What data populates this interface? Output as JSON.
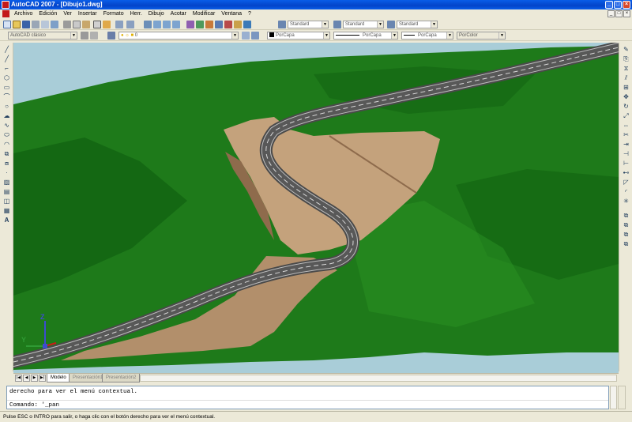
{
  "window": {
    "title": "AutoCAD 2007 - [Dibujo1.dwg]",
    "minimize_glyph": "_",
    "maximize_glyph": "□",
    "close_glyph": "×"
  },
  "menu": {
    "items": [
      {
        "label": "Archivo"
      },
      {
        "label": "Edición"
      },
      {
        "label": "Ver"
      },
      {
        "label": "Insertar"
      },
      {
        "label": "Formato"
      },
      {
        "label": "Herr."
      },
      {
        "label": "Dibujo"
      },
      {
        "label": "Acotar"
      },
      {
        "label": "Modificar"
      },
      {
        "label": "Ventana"
      },
      {
        "label": "?"
      }
    ],
    "doc_min": "_",
    "doc_max": "□",
    "doc_close": "×"
  },
  "toolbar1": {
    "text_style": "Standard",
    "dim_style": "Standard",
    "table_style": "Standard"
  },
  "toolbar2": {
    "workspace": "AutoCAD clásico",
    "layer": "0",
    "color": "PorCapa",
    "linetype": "PorCapa",
    "lineweight": "PorCapa",
    "plotstyle": "PorColor"
  },
  "viewport": {
    "ucs_z": "Z",
    "ucs_y": "Y",
    "colors": {
      "sky": "#a9cdd8",
      "terrain": "#1e7a1a",
      "terrain_dark": "#0d5a0e",
      "earthwork": "#c4a27c",
      "earthwork_shadow": "#8e6b4c",
      "road": "#4a4a4a",
      "road_marking": "#d8d8d8"
    }
  },
  "layout_tabs": {
    "items": [
      {
        "label": "Modelo",
        "active": true
      },
      {
        "label": "Presentación1",
        "active": false
      },
      {
        "label": "Presentación2",
        "active": false
      }
    ],
    "nav": [
      "|◀",
      "◀",
      "▶",
      "▶|"
    ]
  },
  "command": {
    "history_line": "derecho para ver el menú contextual.",
    "prompt_line": "Comando: '_pan"
  },
  "status": {
    "text": "Pulse ESC o INTRO para salir, o haga clic con el botón derecho para ver el menú contextual."
  }
}
